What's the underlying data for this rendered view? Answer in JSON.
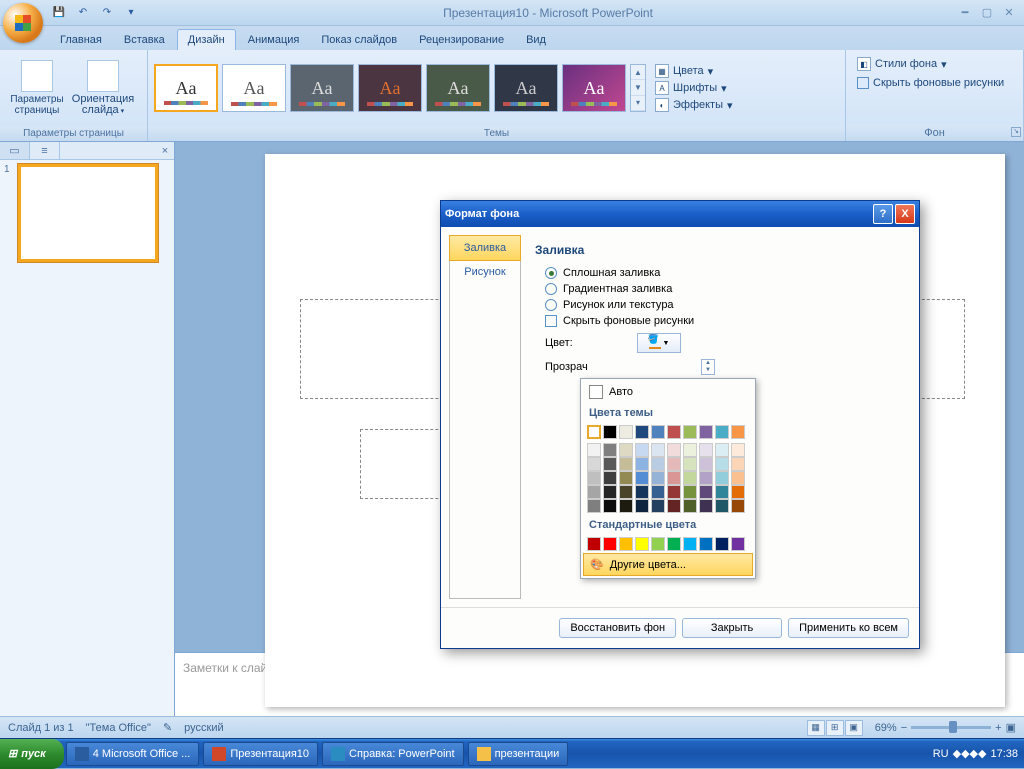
{
  "app_title": "Презентация10 - Microsoft PowerPoint",
  "ribbon_tabs": [
    "Главная",
    "Вставка",
    "Дизайн",
    "Анимация",
    "Показ слайдов",
    "Рецензирование",
    "Вид"
  ],
  "group_labels": {
    "page": "Параметры страницы",
    "themes": "Темы",
    "bg": "Фон"
  },
  "page_buttons": {
    "params": "Параметры\nстраницы",
    "orient": "Ориентация\nслайда"
  },
  "side_ctrls": {
    "colors": "Цвета",
    "fonts": "Шрифты",
    "effects": "Эффекты",
    "styles": "Стили фона",
    "hide": "Скрыть фоновые рисунки"
  },
  "notes_placeholder": "Заметки к слайду",
  "status": {
    "slide": "Слайд 1 из 1",
    "theme": "\"Тема Office\"",
    "lang": "русский",
    "zoom": "69%"
  },
  "taskbar": {
    "start": "пуск",
    "items": [
      "4 Microsoft Office ...",
      "Презентация10",
      "Справка: PowerPoint",
      "презентации"
    ],
    "lang": "RU",
    "time": "17:38"
  },
  "dialog": {
    "title": "Формат фона",
    "side": [
      "Заливка",
      "Рисунок"
    ],
    "heading": "Заливка",
    "radios": [
      "Сплошная заливка",
      "Градиентная заливка",
      "Рисунок или текстура"
    ],
    "checkbox": "Скрыть фоновые рисунки",
    "color_label": "Цвет:",
    "transp_label": "Прозрач",
    "buttons": [
      "Восстановить фон",
      "Закрыть",
      "Применить ко всем"
    ]
  },
  "popup": {
    "auto": "Авто",
    "theme_hdr": "Цвета темы",
    "std_hdr": "Стандартные цвета",
    "more": "Другие цвета...",
    "theme_row1": [
      "#ffffff",
      "#000000",
      "#eeece1",
      "#1f497d",
      "#4f81bd",
      "#c0504d",
      "#9bbb59",
      "#8064a2",
      "#4bacc6",
      "#f79646"
    ],
    "theme_shades": [
      [
        "#f2f2f2",
        "#7f7f7f",
        "#ddd9c3",
        "#c6d9f0",
        "#dbe5f1",
        "#f2dcdb",
        "#ebf1dd",
        "#e5e0ec",
        "#dbeef3",
        "#fdeada"
      ],
      [
        "#d8d8d8",
        "#595959",
        "#c4bd97",
        "#8db3e2",
        "#b8cce4",
        "#e5b9b7",
        "#d7e3bc",
        "#ccc1d9",
        "#b7dde8",
        "#fbd5b5"
      ],
      [
        "#bfbfbf",
        "#3f3f3f",
        "#938953",
        "#548dd4",
        "#95b3d7",
        "#d99694",
        "#c3d69b",
        "#b2a2c7",
        "#92cddc",
        "#fac08f"
      ],
      [
        "#a5a5a5",
        "#262626",
        "#494429",
        "#17365d",
        "#366092",
        "#953734",
        "#76923c",
        "#5f497a",
        "#31859b",
        "#e36c09"
      ],
      [
        "#7f7f7f",
        "#0c0c0c",
        "#1d1b10",
        "#0f243e",
        "#244061",
        "#632423",
        "#4f6128",
        "#3f3151",
        "#205867",
        "#974806"
      ]
    ],
    "std": [
      "#c00000",
      "#ff0000",
      "#ffc000",
      "#ffff00",
      "#92d050",
      "#00b050",
      "#00b0f0",
      "#0070c0",
      "#002060",
      "#7030a0"
    ]
  }
}
